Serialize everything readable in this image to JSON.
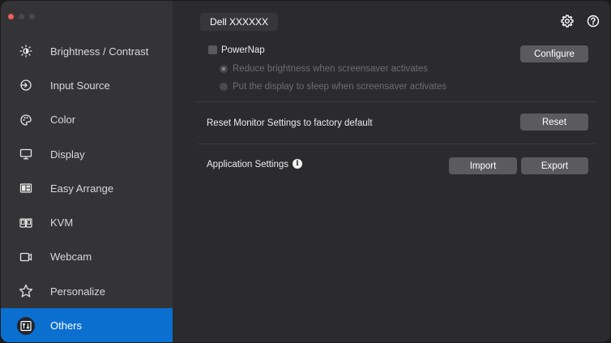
{
  "window": {
    "traffic_colors": [
      "#ec5f5c",
      "#4a4a4c",
      "#4a4a4c"
    ]
  },
  "sidebar": {
    "items": [
      {
        "label": "Brightness / Contrast",
        "icon": "brightness-icon"
      },
      {
        "label": "Input Source",
        "icon": "input-source-icon"
      },
      {
        "label": "Color",
        "icon": "color-palette-icon"
      },
      {
        "label": "Display",
        "icon": "display-monitor-icon"
      },
      {
        "label": "Easy Arrange",
        "icon": "easy-arrange-icon"
      },
      {
        "label": "KVM",
        "icon": "kvm-icon"
      },
      {
        "label": "Webcam",
        "icon": "webcam-icon"
      },
      {
        "label": "Personalize",
        "icon": "star-icon"
      },
      {
        "label": "Others",
        "icon": "others-icon",
        "active": true
      }
    ],
    "active_color": "#0b6fd0"
  },
  "header": {
    "monitor_name": "Dell XXXXXX",
    "settings_icon": "gear-icon",
    "help_icon": "help-icon"
  },
  "powernap": {
    "label": "PowerNap",
    "checked": false,
    "configure_label": "Configure",
    "options": [
      "Reduce brightness when screensaver activates",
      "Put the display to sleep when screensaver activates"
    ]
  },
  "reset": {
    "label": "Reset Monitor Settings to factory default",
    "button_label": "Reset"
  },
  "app_settings": {
    "label": "Application Settings",
    "import_label": "Import",
    "export_label": "Export",
    "info_symbol": "i"
  }
}
